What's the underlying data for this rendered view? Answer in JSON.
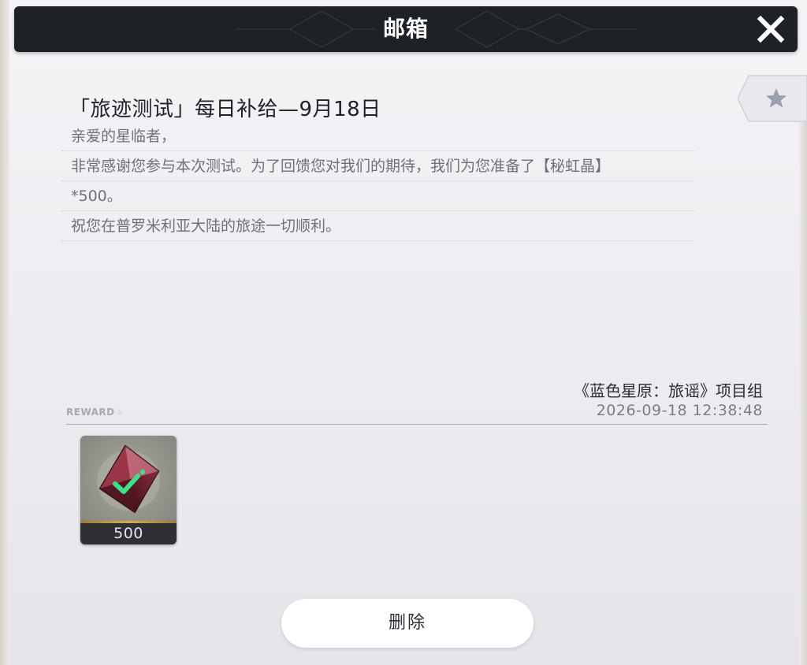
{
  "window": {
    "title": "邮箱"
  },
  "mail": {
    "title": "「旅迹测试」每日补给—9月18日",
    "body_lines": [
      "亲爱的星临者，",
      "非常感谢您参与本次测试。为了回馈您对我们的期待，我们为您准备了【秘虹晶】",
      "*500。",
      "祝您在普罗米利亚大陆的旅途一切顺利。"
    ],
    "sender": "《蓝色星原：旅谣》项目组",
    "timestamp": "2026-09-18 12:38:48"
  },
  "reward": {
    "label": "REWARD",
    "items": [
      {
        "icon": "red-crystal-icon",
        "count": "500",
        "claimed": true
      }
    ]
  },
  "actions": {
    "delete_label": "删除"
  },
  "icons": {
    "close": "close-icon",
    "favorite": "star-icon",
    "claimed": "checkmark-icon"
  },
  "colors": {
    "titlebar_bg": "#1e2125",
    "check_green": "#3ee08a",
    "gold_trim": "#d5ad4d"
  }
}
